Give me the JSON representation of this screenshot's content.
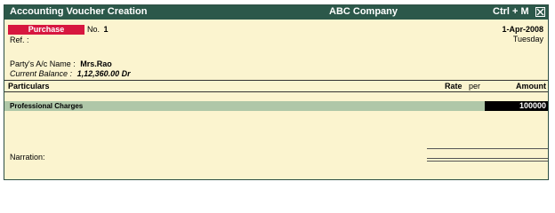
{
  "titlebar": {
    "title": "Accounting Voucher  Creation",
    "company": "ABC Company",
    "shortcut": "Ctrl + M"
  },
  "voucher": {
    "type_label": "Purchase",
    "no_label": "No.",
    "no_value": "1",
    "date": "1-Apr-2008",
    "day": "Tuesday",
    "ref_label": "Ref. :"
  },
  "party": {
    "label": "Party's A/c Name :",
    "name": "Mrs.Rao",
    "balance_label": "Current Balance :",
    "balance_value": "1,12,360.00 Dr"
  },
  "columns": {
    "particulars": "Particulars",
    "rate": "Rate",
    "per": "per",
    "amount": "Amount"
  },
  "rows": [
    {
      "particular": "Professional Charges",
      "amount": "100000"
    }
  ],
  "narration_label": "Narration:",
  "colors": {
    "titlebar": "#2c584a",
    "background": "#fbf4cf",
    "voucher_type": "#d7173f",
    "row_highlight": "#afc7a8"
  }
}
